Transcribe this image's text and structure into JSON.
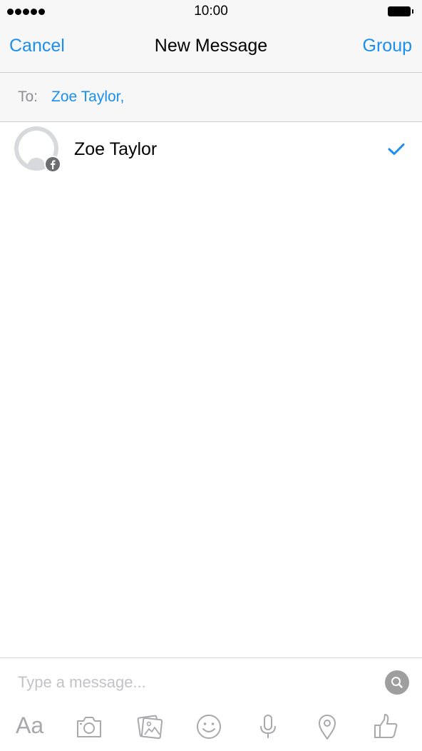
{
  "status_bar": {
    "time": "10:00",
    "signal_icon": "signal-dots-icon",
    "battery_icon": "battery-icon"
  },
  "nav": {
    "left_label": "Cancel",
    "title": "New Message",
    "right_label": "Group"
  },
  "to_field": {
    "label": "To:",
    "recipients": [
      "Zoe Taylor,"
    ]
  },
  "contacts": [
    {
      "name": "Zoe Taylor",
      "avatar_icon": "avatar-placeholder-icon",
      "badge_icon": "facebook-icon",
      "selected": true
    }
  ],
  "composer": {
    "placeholder": "Type a message...",
    "search_icon": "search-icon"
  },
  "toolbar": {
    "text_label": "Aa",
    "icons": [
      "camera-icon",
      "photo-gallery-icon",
      "emoji-icon",
      "microphone-icon",
      "location-pin-icon",
      "thumbs-up-icon"
    ]
  },
  "colors": {
    "accent": "#1a8ff0",
    "bar_background": "#f7f7f7",
    "icon_gray": "#a8a8ad"
  }
}
